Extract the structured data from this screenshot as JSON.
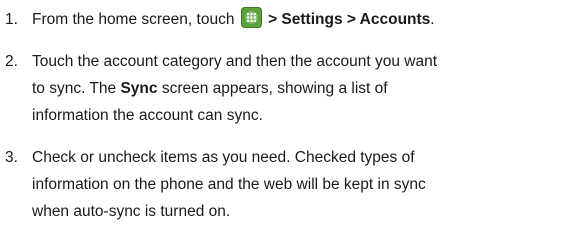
{
  "steps": [
    {
      "number": "1.",
      "text_before": "From the home screen, touch ",
      "icon": "apps-grid-icon",
      "text_after": " > Settings > Accounts",
      "text_end": "."
    },
    {
      "number": "2.",
      "line1": "Touch the account category and then the account you want",
      "line2_before": "to sync. The ",
      "line2_bold": "Sync",
      "line2_after": " screen appears, showing a list of",
      "line3": "information the account can sync."
    },
    {
      "number": "3.",
      "line1": "Check or uncheck items as you need. Checked types of",
      "line2": "information on the phone and the web will be kept in sync",
      "line3": "when auto-sync is turned on."
    }
  ],
  "colors": {
    "text": "#1a1a1a",
    "icon_green": "#5aa23a"
  }
}
